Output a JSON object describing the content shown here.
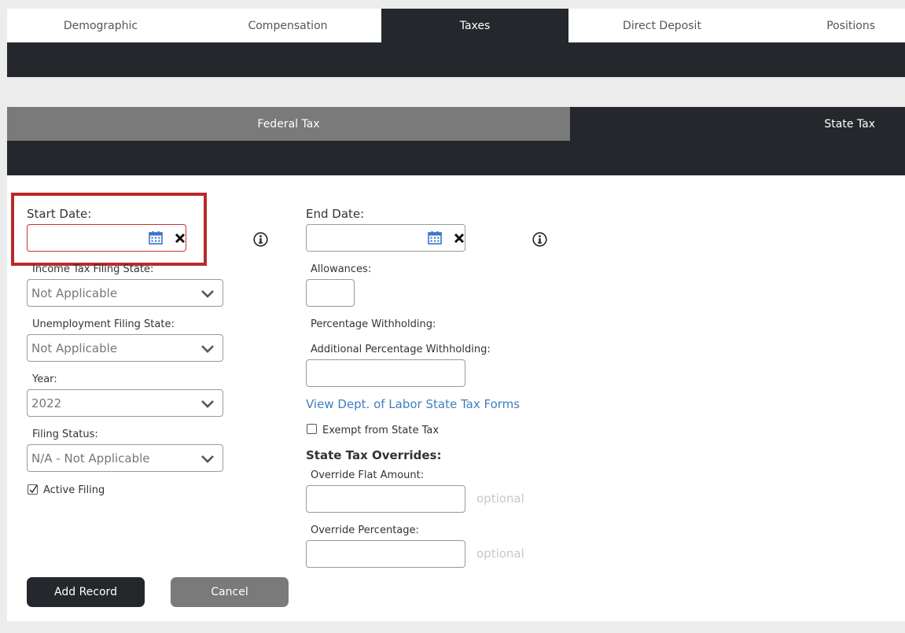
{
  "tabs": [
    "Demographic",
    "Compensation",
    "Taxes",
    "Direct Deposit",
    "Positions"
  ],
  "active_tab": "Taxes",
  "subtabs": {
    "federal": "Federal Tax",
    "state": "State Tax"
  },
  "form": {
    "start_date_label": "Start Date:",
    "start_date_value": "",
    "end_date_label": "End Date:",
    "end_date_value": "",
    "income_state_label": "Income Tax Filing State:",
    "income_state_value": "Not Applicable",
    "unemployment_label": "Unemployment Filing State:",
    "unemployment_value": "Not Applicable",
    "year_label": "Year:",
    "year_value": "2022",
    "filing_status_label": "Filing Status:",
    "filing_status_value": "N/A - Not Applicable",
    "active_filing_label": "Active Filing",
    "allowances_label": "Allowances:",
    "percentage_withholding_label": "Percentage Withholding:",
    "additional_percentage_label": "Additional Percentage Withholding:",
    "dol_link": "View Dept. of Labor State Tax Forms",
    "exempt_label": "Exempt from State Tax",
    "overrides_heading": "State Tax Overrides:",
    "override_flat_label": "Override Flat Amount:",
    "override_pct_label": "Override Percentage:",
    "optional_text": "optional"
  },
  "buttons": {
    "add": "Add Record",
    "cancel": "Cancel"
  },
  "colors": {
    "dark": "#24272c",
    "gray_tab": "#7a7a7a",
    "highlight": "#b82a2a",
    "link": "#3f7fbf",
    "calendar": "#3a74c9"
  }
}
